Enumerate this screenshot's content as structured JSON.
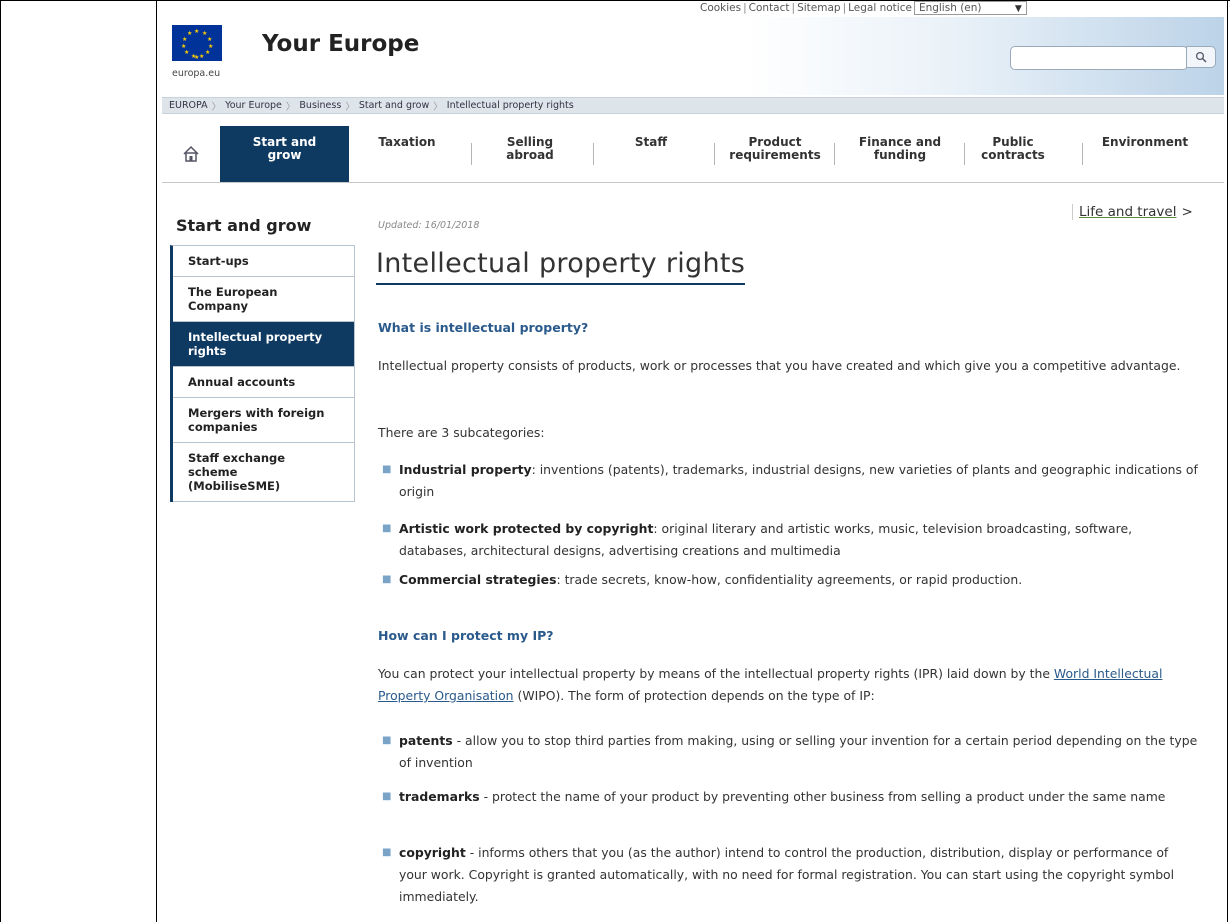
{
  "utility": {
    "cookies": "Cookies",
    "contact": "Contact",
    "sitemap": "Sitemap",
    "legal": "Legal notice",
    "language": "English (en)",
    "separator": "|"
  },
  "header": {
    "europa_label": "europa.eu",
    "site_title": "Your Europe",
    "search_placeholder": ""
  },
  "breadcrumb": [
    "EUROPA",
    "Your Europe",
    "Business",
    "Start and grow",
    "Intellectual property rights"
  ],
  "nav": {
    "tabs": [
      {
        "line1": "Start and",
        "line2": "grow"
      },
      {
        "line1": "Taxation",
        "line2": ""
      },
      {
        "line1": "Selling",
        "line2": "abroad"
      },
      {
        "line1": "Staff",
        "line2": ""
      },
      {
        "line1": "Product",
        "line2": "requirements"
      },
      {
        "line1": "Finance and",
        "line2": "funding"
      },
      {
        "line1": "Public",
        "line2": "contracts"
      },
      {
        "line1": "Environment",
        "line2": ""
      }
    ]
  },
  "sidebar": {
    "title": "Start and grow",
    "items": [
      {
        "label": "Start-ups"
      },
      {
        "label": "The European Company"
      },
      {
        "label": "Intellectual property rights"
      },
      {
        "label": "Annual accounts"
      },
      {
        "label": "Mergers with foreign companies"
      },
      {
        "label": "Staff exchange scheme (MobiliseSME)"
      }
    ]
  },
  "content": {
    "updated": "Updated: 16/01/2018",
    "life_travel": "Life and travel",
    "life_travel_arrow": ">",
    "title": "Intellectual property rights",
    "h_what": "What is intellectual property?",
    "p_what": "Intellectual property consists of products, work or processes that you have created and which give you a competitive advantage.",
    "p_sub": "There are 3 subcategories:",
    "subcats": [
      {
        "term": "Industrial property",
        "text": ": inventions (patents), trademarks, industrial designs, new varieties of plants and geographic indications of origin"
      },
      {
        "term": "Artistic work protected by copyright",
        "text": ": original literary and artistic works, music, television broadcasting, software, databases, architectural designs, advertising creations and multimedia"
      },
      {
        "term": "Commercial strategies",
        "text": ": trade secrets, know-how, confidentiality agreements, or rapid production."
      }
    ],
    "h_protect": "How can I protect my IP?",
    "p_protect_a": "You can protect your intellectual property by means of the intellectual property rights (IPR) laid down by the ",
    "wipo_link": "World Intellectual Property Organisation",
    "p_protect_b": " (WIPO). The form of protection depends on the type of IP:",
    "rights": [
      {
        "term": "patents",
        "text": " - allow you to stop third parties from making, using or selling your invention for a certain period depending on the type of invention"
      },
      {
        "term": "trademarks",
        "text": " - protect the name of your product by preventing other business from selling a product under the same name"
      },
      {
        "term": "copyright",
        "text": " - informs others that you (as the author) intend to control the production, distribution, display or performance of your work. Copyright is granted automatically, with no need for formal registration. You can start using the copyright symbol immediately."
      }
    ]
  }
}
